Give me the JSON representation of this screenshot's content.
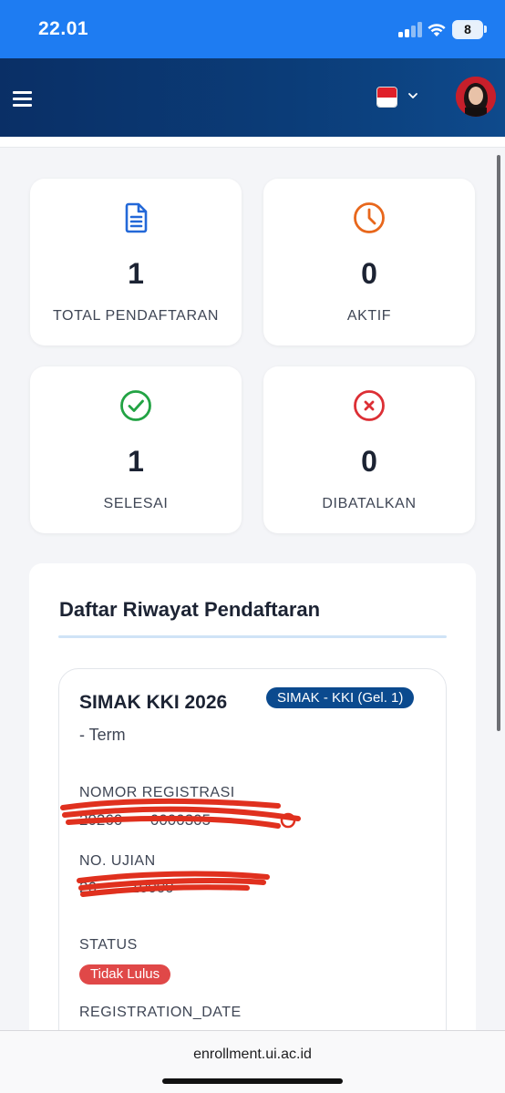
{
  "status_bar": {
    "time": "22.01",
    "battery": "8"
  },
  "navbar": {
    "language_icon": "indonesia-flag-icon",
    "menu_icon": "hamburger-icon",
    "avatar": "user-avatar"
  },
  "stats": [
    {
      "value": "1",
      "label": "TOTAL PENDAFTARAN",
      "icon": "document-icon",
      "color": "#2368d8"
    },
    {
      "value": "0",
      "label": "AKTIF",
      "icon": "clock-icon",
      "color": "#e8671c"
    },
    {
      "value": "1",
      "label": "SELESAI",
      "icon": "check-circle-icon",
      "color": "#22a344"
    },
    {
      "value": "0",
      "label": "DIBATALKAN",
      "icon": "x-circle-icon",
      "color": "#dc2f35"
    }
  ],
  "history": {
    "title": "Daftar Riwayat Pendaftaran",
    "items": [
      {
        "title": "SIMAK KKI 2026",
        "badge": "SIMAK - KKI (Gel. 1)",
        "term": "- Term",
        "registration_label": "NOMOR REGISTRASI",
        "registration_value": "20260         0000305",
        "exam_label": "NO. UJIAN",
        "exam_value": "26           10000",
        "status_label": "STATUS",
        "status_value": "Tidak Lulus",
        "date_label": "REGISTRATION_DATE"
      }
    ]
  },
  "url_bar": {
    "url": "enrollment.ui.ac.id"
  }
}
